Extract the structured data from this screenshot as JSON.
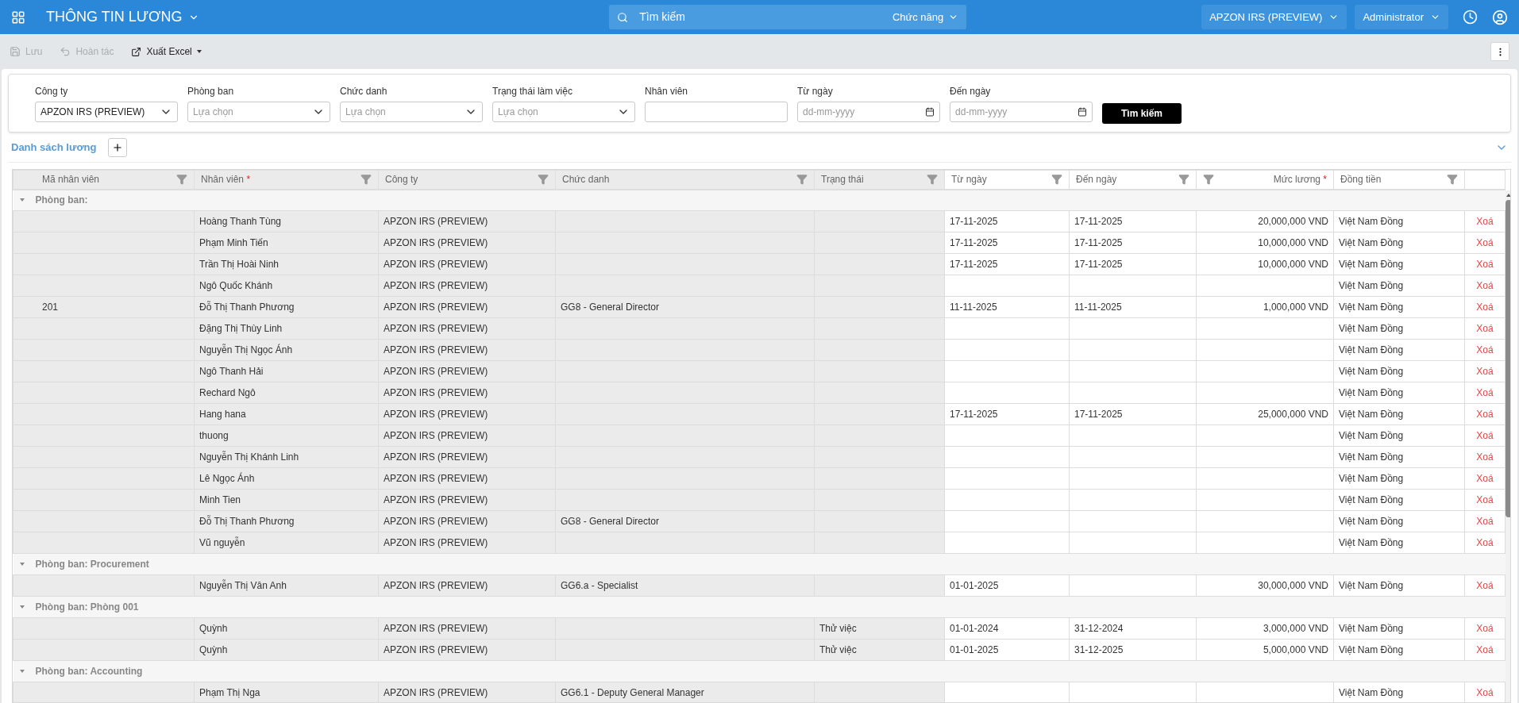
{
  "header": {
    "title": "THÔNG TIN LƯƠNG",
    "search": {
      "placeholder": "Tìm kiếm",
      "scope": "Chức năng"
    },
    "company": "APZON IRS (PREVIEW)",
    "user": "Administrator"
  },
  "toolbar": [
    {
      "label": "Lưu",
      "disabled": true,
      "dropdown": false
    },
    {
      "label": "Hoàn tác",
      "disabled": true,
      "dropdown": false
    },
    {
      "label": "Xuất Excel",
      "disabled": false,
      "dropdown": true
    }
  ],
  "filters": [
    {
      "label": "Công ty",
      "kind": "select",
      "value": "APZON IRS (PREVIEW)"
    },
    {
      "label": "Phòng ban",
      "kind": "select",
      "placeholder": "Lựa chọn"
    },
    {
      "label": "Chức danh",
      "kind": "select",
      "placeholder": "Lựa chọn"
    },
    {
      "label": "Trạng thái làm việc",
      "kind": "select",
      "placeholder": "Lựa chọn"
    },
    {
      "label": "Nhân viên",
      "kind": "text"
    },
    {
      "label": "Từ ngày",
      "kind": "date",
      "placeholder": "dd-mm-yyyy"
    },
    {
      "label": "Đến ngày",
      "kind": "date",
      "placeholder": "dd-mm-yyyy"
    }
  ],
  "search_button": "Tìm kiếm",
  "section_title": "Danh sách lương",
  "table": {
    "columns": [
      {
        "label": "Mã nhân viên",
        "kind": "text",
        "readonly": true
      },
      {
        "label": "Nhân viên",
        "required_mark": "*",
        "kind": "text",
        "readonly": true
      },
      {
        "label": "Công ty",
        "kind": "text",
        "readonly": true
      },
      {
        "label": "Chức danh",
        "kind": "text",
        "readonly": true
      },
      {
        "label": "Trạng thái",
        "kind": "text",
        "readonly": true
      },
      {
        "label": "Từ ngày",
        "kind": "text",
        "readonly": false
      },
      {
        "label": "Đến ngày",
        "kind": "text",
        "readonly": false
      },
      {
        "label": "Mức lương",
        "required_mark": "*",
        "kind": "money",
        "readonly": false
      },
      {
        "label": "Đồng tiền",
        "kind": "text",
        "readonly": false
      }
    ],
    "rows": [
      {
        "kind": "group",
        "label": "Phòng ban:",
        "expanded": true
      },
      {
        "kind": "row",
        "cells": [
          "",
          "Hoàng Thanh Tùng",
          "APZON IRS (PREVIEW)",
          "",
          "",
          "17-11-2025",
          "17-11-2025",
          "20,000,000 VND",
          "Việt Nam Đồng"
        ],
        "action": "Xoá"
      },
      {
        "kind": "row",
        "cells": [
          "",
          "Phạm Minh Tiến",
          "APZON IRS (PREVIEW)",
          "",
          "",
          "17-11-2025",
          "17-11-2025",
          "10,000,000 VND",
          "Việt Nam Đồng"
        ],
        "action": "Xoá"
      },
      {
        "kind": "row",
        "cells": [
          "",
          "Trần Thị Hoài Ninh",
          "APZON IRS (PREVIEW)",
          "",
          "",
          "17-11-2025",
          "17-11-2025",
          "10,000,000 VND",
          "Việt Nam Đồng"
        ],
        "action": "Xoá"
      },
      {
        "kind": "row",
        "cells": [
          "",
          "Ngô Quốc Khánh",
          "APZON IRS (PREVIEW)",
          "",
          "",
          "",
          "",
          "",
          "Việt Nam Đồng"
        ],
        "action": "Xoá"
      },
      {
        "kind": "row",
        "cells": [
          "201",
          "Đỗ Thị Thanh Phương",
          "APZON IRS (PREVIEW)",
          "GG8 - General Director",
          "",
          "11-11-2025",
          "11-11-2025",
          "1,000,000 VND",
          "Việt Nam Đồng"
        ],
        "action": "Xoá"
      },
      {
        "kind": "row",
        "cells": [
          "",
          "Đặng Thị Thùy Linh",
          "APZON IRS (PREVIEW)",
          "",
          "",
          "",
          "",
          "",
          "Việt Nam Đồng"
        ],
        "action": "Xoá"
      },
      {
        "kind": "row",
        "cells": [
          "",
          "Nguyễn Thị Ngọc Ánh",
          "APZON IRS (PREVIEW)",
          "",
          "",
          "",
          "",
          "",
          "Việt Nam Đồng"
        ],
        "action": "Xoá"
      },
      {
        "kind": "row",
        "cells": [
          "",
          "Ngô Thanh Hải",
          "APZON IRS (PREVIEW)",
          "",
          "",
          "",
          "",
          "",
          "Việt Nam Đồng"
        ],
        "action": "Xoá"
      },
      {
        "kind": "row",
        "cells": [
          "",
          "Rechard Ngô",
          "APZON IRS (PREVIEW)",
          "",
          "",
          "",
          "",
          "",
          "Việt Nam Đồng"
        ],
        "action": "Xoá"
      },
      {
        "kind": "row",
        "cells": [
          "",
          "Hang hana",
          "APZON IRS (PREVIEW)",
          "",
          "",
          "17-11-2025",
          "17-11-2025",
          "25,000,000 VND",
          "Việt Nam Đồng"
        ],
        "action": "Xoá"
      },
      {
        "kind": "row",
        "cells": [
          "",
          "thuong",
          "APZON IRS (PREVIEW)",
          "",
          "",
          "",
          "",
          "",
          "Việt Nam Đồng"
        ],
        "action": "Xoá"
      },
      {
        "kind": "row",
        "cells": [
          "",
          "Nguyễn Thị Khánh Linh",
          "APZON IRS (PREVIEW)",
          "",
          "",
          "",
          "",
          "",
          "Việt Nam Đồng"
        ],
        "action": "Xoá"
      },
      {
        "kind": "row",
        "cells": [
          "",
          "Lê Ngọc Ánh",
          "APZON IRS (PREVIEW)",
          "",
          "",
          "",
          "",
          "",
          "Việt Nam Đồng"
        ],
        "action": "Xoá"
      },
      {
        "kind": "row",
        "cells": [
          "",
          "Minh Tien",
          "APZON IRS (PREVIEW)",
          "",
          "",
          "",
          "",
          "",
          "Việt Nam Đồng"
        ],
        "action": "Xoá"
      },
      {
        "kind": "row",
        "cells": [
          "",
          "Đỗ Thị Thanh Phương",
          "APZON IRS (PREVIEW)",
          "GG8 - General Director",
          "",
          "",
          "",
          "",
          "Việt Nam Đồng"
        ],
        "action": "Xoá"
      },
      {
        "kind": "row",
        "cells": [
          "",
          "Vũ nguyễn",
          "APZON IRS (PREVIEW)",
          "",
          "",
          "",
          "",
          "",
          "Việt Nam Đồng"
        ],
        "action": "Xoá"
      },
      {
        "kind": "group",
        "label": "Phòng ban: Procurement",
        "expanded": true
      },
      {
        "kind": "row",
        "cells": [
          "",
          "Nguyễn Thị Vân Anh",
          "APZON IRS (PREVIEW)",
          "GG6.a - Specialist",
          "",
          "01-01-2025",
          "",
          "30,000,000 VND",
          "Việt Nam Đồng"
        ],
        "action": "Xoá"
      },
      {
        "kind": "group",
        "label": "Phòng ban: Phòng 001",
        "expanded": true
      },
      {
        "kind": "row",
        "cells": [
          "",
          "Quỳnh",
          "APZON IRS (PREVIEW)",
          "",
          "Thử việc",
          "01-01-2024",
          "31-12-2024",
          "3,000,000 VND",
          "Việt Nam Đồng"
        ],
        "action": "Xoá"
      },
      {
        "kind": "row",
        "cells": [
          "",
          "Quỳnh",
          "APZON IRS (PREVIEW)",
          "",
          "Thử việc",
          "01-01-2025",
          "31-12-2025",
          "5,000,000 VND",
          "Việt Nam Đồng"
        ],
        "action": "Xoá"
      },
      {
        "kind": "group",
        "label": "Phòng ban: Accounting",
        "expanded": true
      },
      {
        "kind": "row",
        "cells": [
          "",
          "Phạm Thị Nga",
          "APZON IRS (PREVIEW)",
          "GG6.1 - Deputy General Manager",
          "",
          "",
          "",
          "",
          "Việt Nam Đồng"
        ],
        "action": "Xoá"
      }
    ]
  }
}
